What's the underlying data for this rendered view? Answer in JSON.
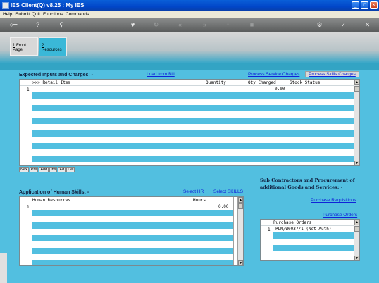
{
  "window": {
    "title": "IES Client(Q) v8.25 : My IES"
  },
  "menu": [
    "Help",
    "Submit",
    "Quit",
    "Functions",
    "Commands"
  ],
  "tabs": [
    {
      "num": "1",
      "label": "Front Page"
    },
    {
      "num": "2",
      "label": "Resources"
    }
  ],
  "inputs_section": {
    "title": "Expected Inputs and Charges: -",
    "load_from_bill": "Load from Bill",
    "process_service": "Process Service Charges",
    "process_skills": "Process Skills Charges",
    "columns": [
      ">>> Retail Item",
      "Quantity",
      "Qty Charged",
      "Stock Status"
    ],
    "rows": [
      {
        "num": "1",
        "qty_charged": "0.00"
      }
    ],
    "nav": [
      "Nex",
      "Pre",
      "Add",
      "Ins",
      "Ed",
      "Del"
    ]
  },
  "skills_section": {
    "title": "Application of Human Skills: -",
    "select_hr": "Select HR",
    "select_skills": "Select SKILLS",
    "columns": [
      "Human Resources",
      "Hours"
    ],
    "rows": [
      {
        "num": "1",
        "hours": "0.00"
      }
    ]
  },
  "subcontract_section": {
    "title_line1": "Sub Contractors and Procurement of",
    "title_line2": "additional Goods and Services: -",
    "purchase_requisitions": "Purchase Requisitions",
    "purchase_orders_link": "Purchase Orders",
    "columns": [
      "Purchase Orders"
    ],
    "rows": [
      {
        "num": "1",
        "value": "PLM/W0037/1 (Not Auth)"
      }
    ]
  },
  "colors": {
    "accent": "#52bfe0",
    "link": "#1022d8"
  }
}
